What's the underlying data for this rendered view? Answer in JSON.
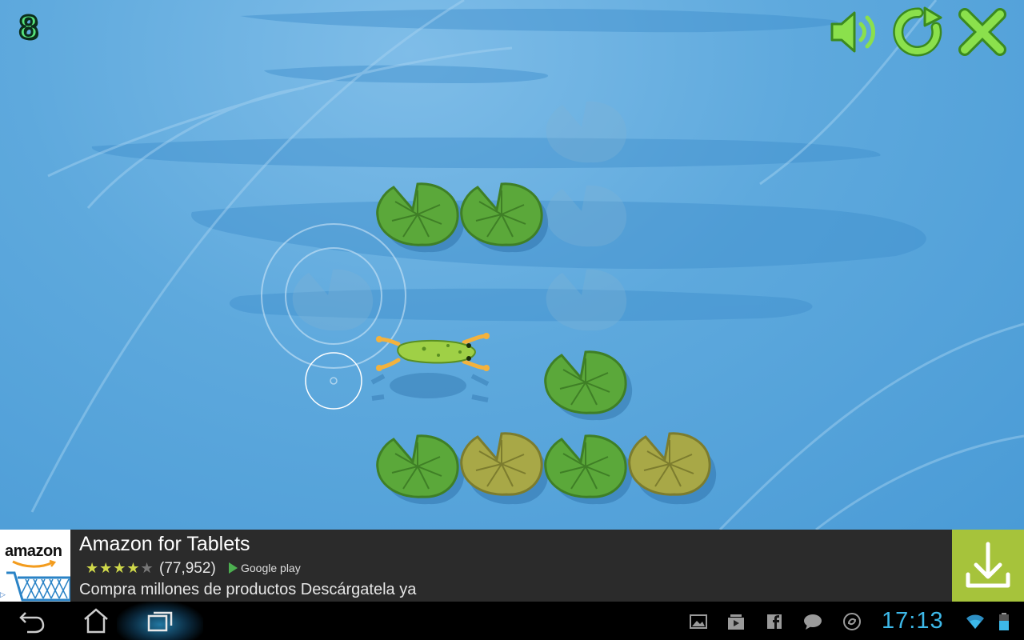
{
  "game": {
    "level": "8",
    "buttons": {
      "sound": "sound-on-icon",
      "restart": "restart-icon",
      "close": "close-icon"
    },
    "accent_color": "#7ee04a"
  },
  "ad": {
    "logo_text": "amazon",
    "title": "Amazon for Tablets",
    "rating_stars": 4,
    "rating_max": 5,
    "rating_count": "(77,952)",
    "store": "Google play",
    "description": "Compra millones de productos Descárgatela ya",
    "choice_mark": "▷",
    "download_color": "#a6c33b"
  },
  "navbar": {
    "back": "back-icon",
    "home": "home-icon",
    "recent": "recent-apps-icon",
    "tray_icons": [
      "gallery-icon",
      "video-icon",
      "facebook-icon",
      "chat-icon",
      "sync-icon",
      "wifi-icon",
      "battery-icon"
    ],
    "time": "17:13",
    "clock_color": "#3db8e8"
  }
}
